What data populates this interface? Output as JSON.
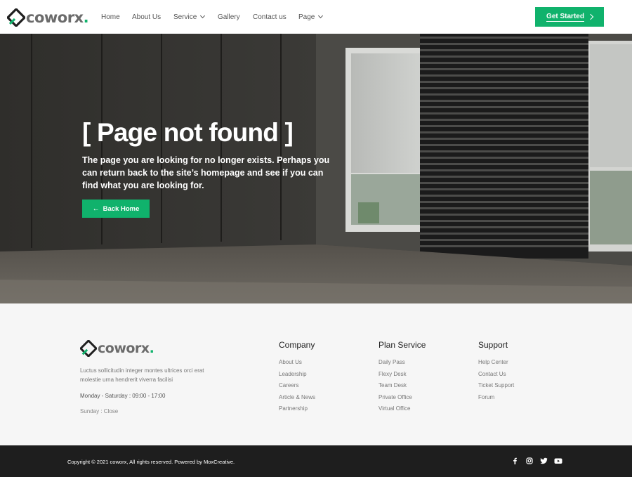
{
  "brand": {
    "name": "coworx",
    "dot": "."
  },
  "nav": {
    "items": [
      {
        "label": "Home",
        "dropdown": false
      },
      {
        "label": "About Us",
        "dropdown": false
      },
      {
        "label": "Service",
        "dropdown": true
      },
      {
        "label": "Gallery",
        "dropdown": false
      },
      {
        "label": "Contact us",
        "dropdown": false
      },
      {
        "label": "Page",
        "dropdown": true
      }
    ],
    "cta_label": "Get Started"
  },
  "hero": {
    "title": "[ Page not found ]",
    "text": "The page you are looking for no longer exists. Perhaps you can return back to the site’s homepage and see if you can find what you are looking for.",
    "button_label": "Back Home"
  },
  "footer": {
    "description": "Luctus sollicitudin integer montes ultrices orci erat molestie urna hendrerit viverra facilisi",
    "hours_weekday": "Monday - Saturday :  09:00 - 17:00",
    "hours_sunday": "Sunday :  Close",
    "columns": [
      {
        "title": "Company",
        "links": [
          "About Us",
          "Leadership",
          "Careers",
          "Article & News",
          "Partnership"
        ]
      },
      {
        "title": "Plan Service",
        "links": [
          "Daily Pass",
          "Flexy Desk",
          "Team Desk",
          "Private Office",
          "Virtual Office"
        ]
      },
      {
        "title": "Support",
        "links": [
          "Help Center",
          "Contact Us",
          "Ticket Support",
          "Forum"
        ]
      }
    ],
    "copyright": "Copyright © 2021 coworx, All rights reserved. Powered by MoxCreative."
  },
  "social": [
    "facebook-icon",
    "instagram-icon",
    "twitter-icon",
    "youtube-icon"
  ],
  "colors": {
    "accent": "#10b26c",
    "footer_bg": "#f6f6f6",
    "bottom_bar": "#1e1e1e",
    "logo_text": "#6b6b6b"
  }
}
